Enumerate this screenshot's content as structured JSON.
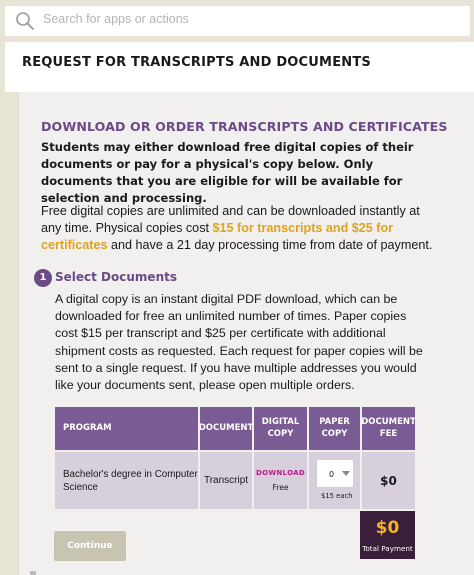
{
  "search": {
    "placeholder": "Search for apps or actions"
  },
  "page": {
    "title": "REQUEST FOR TRANSCRIPTS AND DOCUMENTS"
  },
  "section": {
    "heading": "DOWNLOAD OR ORDER TRANSCRIPTS AND CERTIFICATES",
    "intro_bold": "Students may either download free digital copies of their documents or pay for a physical's copy below. Only documents that you are eligible for will be available for selection and processing.",
    "free_text_1": "Free digital copies are unlimited and can be downloaded instantly at any time. Physical copies cost ",
    "free_text_highlight": "$15 for transcripts and $25 for certificates",
    "free_text_2": " and have a 21 day processing time from date of payment."
  },
  "step": {
    "number": "1",
    "label": "Select Documents",
    "description": "A digital copy is an instant digital PDF download, which can be downloaded for free an unlimited number of times. Paper copies cost $15 per transcript and $25 per certificate with additional shipment costs as requested. Each request for paper copies will be sent to a single request. If you have multiple addresses you would like your documents sent, please open multiple orders."
  },
  "table": {
    "headers": {
      "program": "PROGRAM",
      "document": "DOCUMENT",
      "digital": "DIGITAL COPY",
      "paper": "PAPER COPY",
      "fee": "DOCUMENT FEE"
    },
    "row": {
      "program": "Bachelor's degree in Computer Science",
      "document": "Transcript",
      "download_label": "DOWNLOAD",
      "free_label": "Free",
      "paper_qty": "0",
      "paper_each": "$15 each",
      "fee": "$0"
    }
  },
  "total": {
    "amount": "$0",
    "label": "Total Payment"
  },
  "actions": {
    "continue_label": "Continue"
  },
  "colors": {
    "accent_purple": "#6b4a87",
    "header_purple": "#7a5b94",
    "row_lavender": "#d7cfdc",
    "highlight_gold": "#e0a21f",
    "total_dark": "#3a1f3a",
    "download_magenta": "#c2188b",
    "continue_disabled": "#c7c5b2"
  },
  "icons": {
    "search": "search-icon",
    "caret": "chevron-down-icon"
  }
}
